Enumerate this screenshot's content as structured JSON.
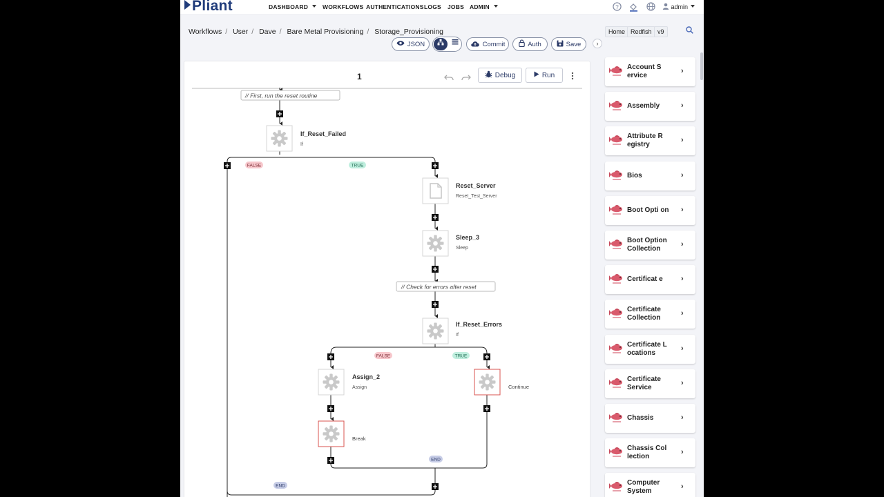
{
  "brand": "Pliant",
  "nav": [
    {
      "label": "DASHBOARD",
      "has_caret": true
    },
    {
      "label": "WORKFLOWS",
      "has_caret": false
    },
    {
      "label": "AUTHENTICATIONS",
      "has_caret": false
    },
    {
      "label": "LOGS",
      "has_caret": false
    },
    {
      "label": "JOBS",
      "has_caret": false
    },
    {
      "label": "ADMIN",
      "has_caret": true
    }
  ],
  "header_icons": [
    "help-icon",
    "paint-bucket-icon",
    "globe-icon",
    "user-icon"
  ],
  "user": "admin",
  "breadcrumb": [
    "Workflows",
    "User",
    "Dave",
    "Bare Metal Provisioning",
    "Storage_Provisioning"
  ],
  "toolbar": {
    "json": "JSON",
    "commit": "Commit",
    "auth": "Auth",
    "save": "Save"
  },
  "canvas": {
    "title": "1",
    "debug": "Debug",
    "run": "Run"
  },
  "flow": {
    "comments": [
      "// First, run the reset routine",
      "// Check for errors after reset"
    ],
    "nodes": [
      {
        "name": "If_Reset_Failed",
        "type": "If"
      },
      {
        "name": "Reset_Server",
        "type": "Reset_Test_Server"
      },
      {
        "name": "Sleep_3",
        "type": "Sleep"
      },
      {
        "name": "If_Reset_Errors",
        "type": "If"
      },
      {
        "name": "Assign_2",
        "type": "Assign"
      },
      {
        "name": "Continue",
        "type": ""
      },
      {
        "name": "Break",
        "type": ""
      }
    ],
    "badges": {
      "false": "FALSE",
      "true": "TRUE",
      "end": "END"
    }
  },
  "sidebar": {
    "tabs": [
      "Home",
      "Redfish",
      "v9"
    ],
    "items": [
      {
        "label": "Account S ervice"
      },
      {
        "label": "Assembly"
      },
      {
        "label": "Attribute R egistry"
      },
      {
        "label": "Bios"
      },
      {
        "label": "Boot Opti on"
      },
      {
        "label": "Boot Option Collection"
      },
      {
        "label": "Certificat e"
      },
      {
        "label": "Certificate Collection"
      },
      {
        "label": "Certificate L ocations"
      },
      {
        "label": "Certificate Service"
      },
      {
        "label": "Chassis"
      },
      {
        "label": "Chassis Col lection"
      },
      {
        "label": "Computer System"
      }
    ]
  },
  "colors": {
    "brand": "#1f3b7a",
    "primary": "#2b3a67",
    "false_badge": "#f7c7cc",
    "true_badge": "#bfeede",
    "end_badge": "#c6cce6",
    "error_border": "#d9534f"
  }
}
